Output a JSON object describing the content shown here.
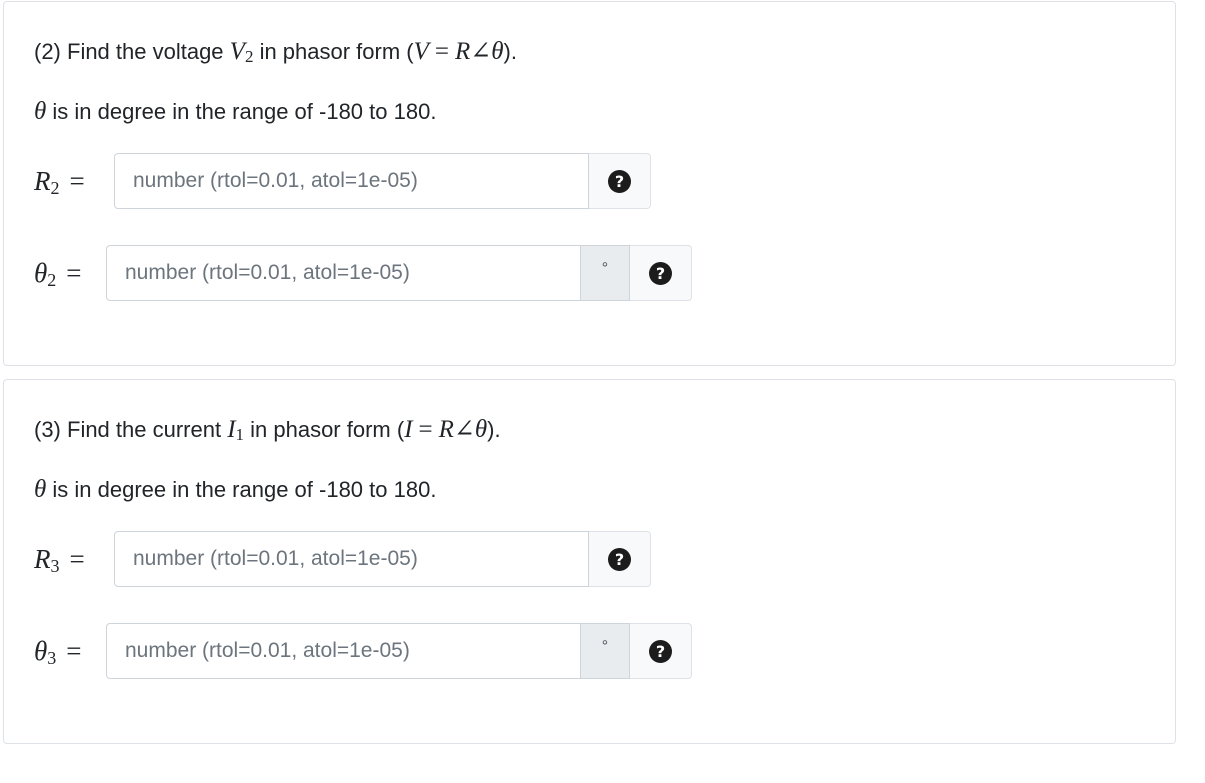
{
  "parts": [
    {
      "prefix": "(2) Find the voltage ",
      "sym": "V",
      "sub": "2",
      "mid": " in phasor form (",
      "expr_lhs": "V",
      "expr_rhs": "R∠θ",
      "end": ").",
      "note_sym": "θ",
      "note_text": " is in degree in the range of -180 to 180.",
      "answers": [
        {
          "sym": "R",
          "sub": "2",
          "eq": "=",
          "placeholder": "number (rtol=0.01, atol=1e-05)",
          "unit": "",
          "help": "?"
        },
        {
          "sym": "θ",
          "sub": "2",
          "eq": "=",
          "placeholder": "number (rtol=0.01, atol=1e-05)",
          "unit": "°",
          "help": "?"
        }
      ]
    },
    {
      "prefix": "(3) Find the current ",
      "sym": "I",
      "sub": "1",
      "mid": " in phasor form (",
      "expr_lhs": "I",
      "expr_rhs": "R∠θ",
      "end": ").",
      "note_sym": "θ",
      "note_text": " is in degree in the range of -180 to 180.",
      "answers": [
        {
          "sym": "R",
          "sub": "3",
          "eq": "=",
          "placeholder": "number (rtol=0.01, atol=1e-05)",
          "unit": "",
          "help": "?"
        },
        {
          "sym": "θ",
          "sub": "3",
          "eq": "=",
          "placeholder": "number (rtol=0.01, atol=1e-05)",
          "unit": "°",
          "help": "?"
        }
      ]
    }
  ]
}
